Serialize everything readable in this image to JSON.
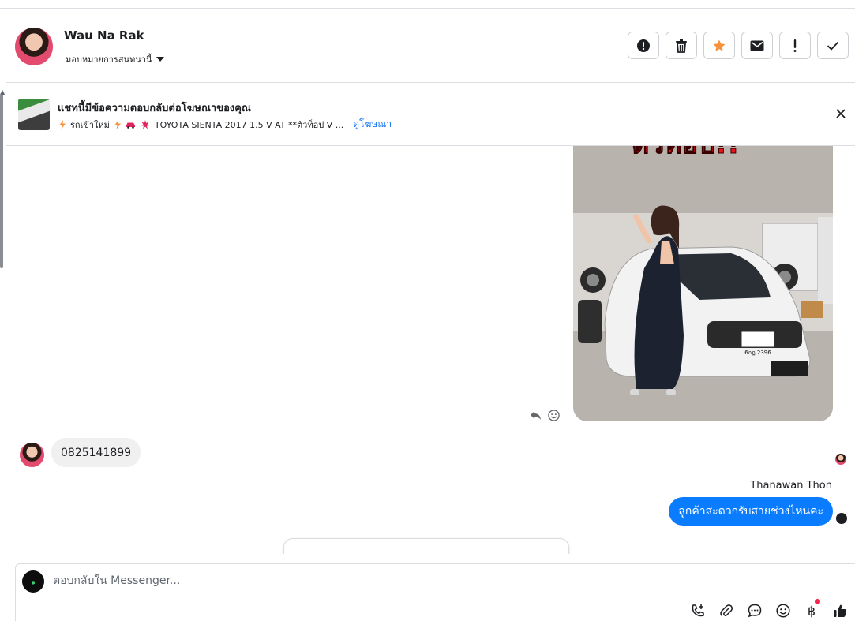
{
  "header": {
    "contact_name": "Wau Na Rak",
    "assign_label": "มอบหมายการสนทนานี้"
  },
  "actions": [
    {
      "name": "report-button",
      "icon": "alert-circle-icon"
    },
    {
      "name": "delete-button",
      "icon": "trash-icon"
    },
    {
      "name": "star-button",
      "icon": "star-icon"
    },
    {
      "name": "mark-unread-button",
      "icon": "envelope-icon"
    },
    {
      "name": "follow-up-button",
      "icon": "exclamation-icon"
    },
    {
      "name": "done-button",
      "icon": "check-icon"
    }
  ],
  "ad": {
    "title": "แชทนี้มีข้อความตอบกลับต่อโฆษณาของคุณ",
    "subtitle": "รถเข้าใหม่",
    "subtitle_rest": "TOYOTA SIENTA 2017 1.5 V AT **ตัวท็อป V ...",
    "link": "ดูโฆษณา"
  },
  "image_message": {
    "overlay_text": "ตัวท็อป!!",
    "plate_text": "6กฎ 2396"
  },
  "messages": {
    "incoming_text": "0825141899",
    "sender_name": "Thanawan Thon",
    "outgoing_text": "ลูกค้าสะดวกรับสายช่วงไหนคะ"
  },
  "composer": {
    "placeholder": "ตอบกลับใน Messenger..."
  },
  "colors": {
    "accent": "#0a7cff",
    "link": "#1877f2",
    "star": "#f7923b"
  }
}
